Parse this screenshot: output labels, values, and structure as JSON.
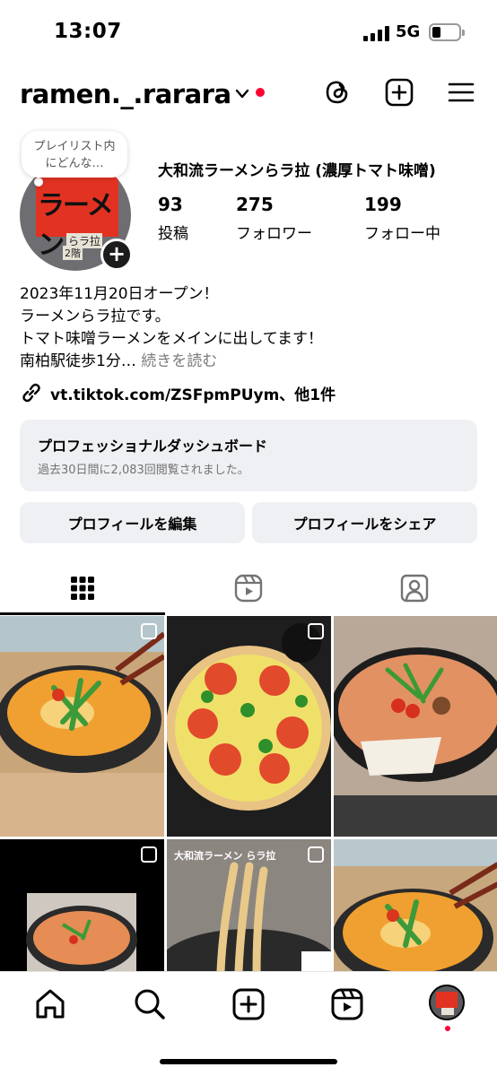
{
  "status_bar": {
    "time": "13:07",
    "network": "5G"
  },
  "header": {
    "username": "ramen._.rarara"
  },
  "note": {
    "text": "プレイリスト内にどんな…"
  },
  "avatar_art": {
    "title": "ラーメン",
    "line1": "らラ拉",
    "line2": "2階"
  },
  "profile": {
    "display_name": "大和流ラーメンらラ拉 (濃厚トマト味噌)",
    "stats": [
      {
        "value": "93",
        "label": "投稿"
      },
      {
        "value": "275",
        "label": "フォロワー"
      },
      {
        "value": "199",
        "label": "フォロー中"
      }
    ],
    "bio_lines": [
      "2023年11月20日オープン！",
      "ラーメンらラ拉です。",
      "トマト味噌ラーメンをメインに出してます！",
      "南柏駅徒歩1分…"
    ],
    "bio_more": "続きを読む",
    "link_text": "vt.tiktok.com/ZSFpmPUym、他1件"
  },
  "dashboard": {
    "title": "プロフェッショナルダッシュボード",
    "subtitle": "過去30日間に2,083回閲覧されました。"
  },
  "buttons": {
    "edit": "プロフィールを編集",
    "share": "プロフィールをシェア"
  },
  "posts": [
    {
      "overlay_text": ""
    },
    {
      "overlay_text": ""
    },
    {
      "overlay_text": ""
    },
    {
      "overlay_text": ""
    },
    {
      "overlay_text": "大和流ラーメン らラ拉"
    },
    {
      "overlay_text": ""
    }
  ],
  "colors": {
    "accent_red": "#ff0033",
    "button_bg": "#eff0f3",
    "muted_text": "#737373"
  }
}
